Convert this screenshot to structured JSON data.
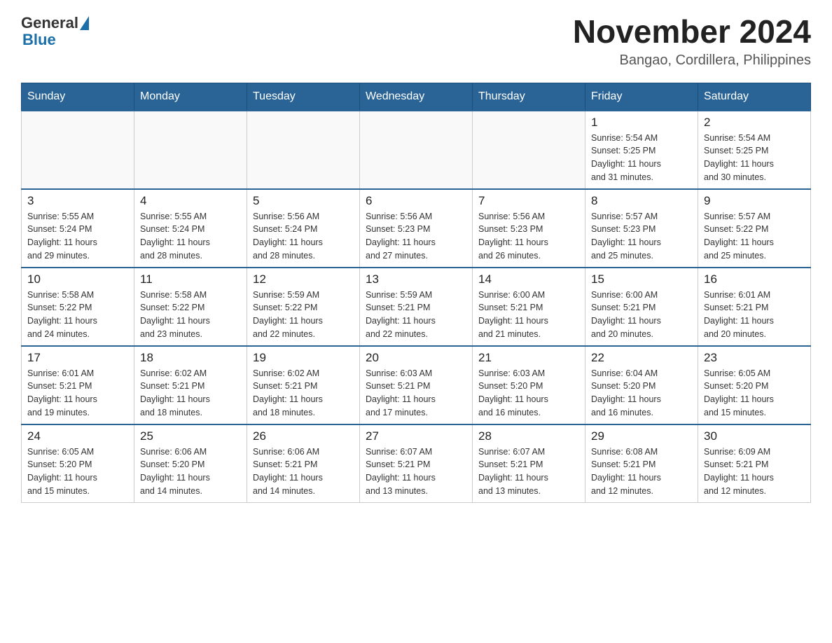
{
  "header": {
    "logo_general": "General",
    "logo_blue": "Blue",
    "main_title": "November 2024",
    "subtitle": "Bangao, Cordillera, Philippines"
  },
  "calendar": {
    "days_of_week": [
      "Sunday",
      "Monday",
      "Tuesday",
      "Wednesday",
      "Thursday",
      "Friday",
      "Saturday"
    ],
    "weeks": [
      [
        {
          "day": "",
          "info": ""
        },
        {
          "day": "",
          "info": ""
        },
        {
          "day": "",
          "info": ""
        },
        {
          "day": "",
          "info": ""
        },
        {
          "day": "",
          "info": ""
        },
        {
          "day": "1",
          "info": "Sunrise: 5:54 AM\nSunset: 5:25 PM\nDaylight: 11 hours\nand 31 minutes."
        },
        {
          "day": "2",
          "info": "Sunrise: 5:54 AM\nSunset: 5:25 PM\nDaylight: 11 hours\nand 30 minutes."
        }
      ],
      [
        {
          "day": "3",
          "info": "Sunrise: 5:55 AM\nSunset: 5:24 PM\nDaylight: 11 hours\nand 29 minutes."
        },
        {
          "day": "4",
          "info": "Sunrise: 5:55 AM\nSunset: 5:24 PM\nDaylight: 11 hours\nand 28 minutes."
        },
        {
          "day": "5",
          "info": "Sunrise: 5:56 AM\nSunset: 5:24 PM\nDaylight: 11 hours\nand 28 minutes."
        },
        {
          "day": "6",
          "info": "Sunrise: 5:56 AM\nSunset: 5:23 PM\nDaylight: 11 hours\nand 27 minutes."
        },
        {
          "day": "7",
          "info": "Sunrise: 5:56 AM\nSunset: 5:23 PM\nDaylight: 11 hours\nand 26 minutes."
        },
        {
          "day": "8",
          "info": "Sunrise: 5:57 AM\nSunset: 5:23 PM\nDaylight: 11 hours\nand 25 minutes."
        },
        {
          "day": "9",
          "info": "Sunrise: 5:57 AM\nSunset: 5:22 PM\nDaylight: 11 hours\nand 25 minutes."
        }
      ],
      [
        {
          "day": "10",
          "info": "Sunrise: 5:58 AM\nSunset: 5:22 PM\nDaylight: 11 hours\nand 24 minutes."
        },
        {
          "day": "11",
          "info": "Sunrise: 5:58 AM\nSunset: 5:22 PM\nDaylight: 11 hours\nand 23 minutes."
        },
        {
          "day": "12",
          "info": "Sunrise: 5:59 AM\nSunset: 5:22 PM\nDaylight: 11 hours\nand 22 minutes."
        },
        {
          "day": "13",
          "info": "Sunrise: 5:59 AM\nSunset: 5:21 PM\nDaylight: 11 hours\nand 22 minutes."
        },
        {
          "day": "14",
          "info": "Sunrise: 6:00 AM\nSunset: 5:21 PM\nDaylight: 11 hours\nand 21 minutes."
        },
        {
          "day": "15",
          "info": "Sunrise: 6:00 AM\nSunset: 5:21 PM\nDaylight: 11 hours\nand 20 minutes."
        },
        {
          "day": "16",
          "info": "Sunrise: 6:01 AM\nSunset: 5:21 PM\nDaylight: 11 hours\nand 20 minutes."
        }
      ],
      [
        {
          "day": "17",
          "info": "Sunrise: 6:01 AM\nSunset: 5:21 PM\nDaylight: 11 hours\nand 19 minutes."
        },
        {
          "day": "18",
          "info": "Sunrise: 6:02 AM\nSunset: 5:21 PM\nDaylight: 11 hours\nand 18 minutes."
        },
        {
          "day": "19",
          "info": "Sunrise: 6:02 AM\nSunset: 5:21 PM\nDaylight: 11 hours\nand 18 minutes."
        },
        {
          "day": "20",
          "info": "Sunrise: 6:03 AM\nSunset: 5:21 PM\nDaylight: 11 hours\nand 17 minutes."
        },
        {
          "day": "21",
          "info": "Sunrise: 6:03 AM\nSunset: 5:20 PM\nDaylight: 11 hours\nand 16 minutes."
        },
        {
          "day": "22",
          "info": "Sunrise: 6:04 AM\nSunset: 5:20 PM\nDaylight: 11 hours\nand 16 minutes."
        },
        {
          "day": "23",
          "info": "Sunrise: 6:05 AM\nSunset: 5:20 PM\nDaylight: 11 hours\nand 15 minutes."
        }
      ],
      [
        {
          "day": "24",
          "info": "Sunrise: 6:05 AM\nSunset: 5:20 PM\nDaylight: 11 hours\nand 15 minutes."
        },
        {
          "day": "25",
          "info": "Sunrise: 6:06 AM\nSunset: 5:20 PM\nDaylight: 11 hours\nand 14 minutes."
        },
        {
          "day": "26",
          "info": "Sunrise: 6:06 AM\nSunset: 5:21 PM\nDaylight: 11 hours\nand 14 minutes."
        },
        {
          "day": "27",
          "info": "Sunrise: 6:07 AM\nSunset: 5:21 PM\nDaylight: 11 hours\nand 13 minutes."
        },
        {
          "day": "28",
          "info": "Sunrise: 6:07 AM\nSunset: 5:21 PM\nDaylight: 11 hours\nand 13 minutes."
        },
        {
          "day": "29",
          "info": "Sunrise: 6:08 AM\nSunset: 5:21 PM\nDaylight: 11 hours\nand 12 minutes."
        },
        {
          "day": "30",
          "info": "Sunrise: 6:09 AM\nSunset: 5:21 PM\nDaylight: 11 hours\nand 12 minutes."
        }
      ]
    ]
  }
}
